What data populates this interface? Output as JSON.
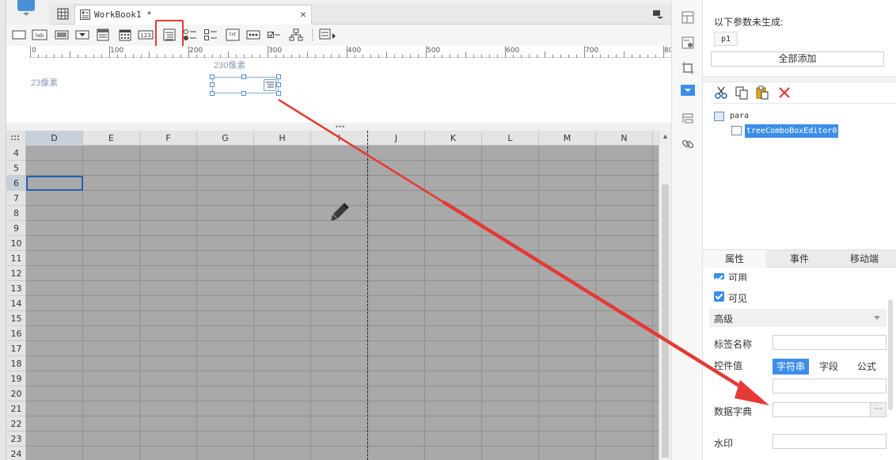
{
  "tab": {
    "title": "WorkBook1 *",
    "close_glyph": "×"
  },
  "toolbar": {
    "items": [
      {
        "icon": "text-box-icon"
      },
      {
        "icon": "label-icon",
        "text": "lab"
      },
      {
        "icon": "button-icon"
      },
      {
        "icon": "dropdown-icon"
      },
      {
        "icon": "combo-list-icon"
      },
      {
        "icon": "date-picker-icon"
      },
      {
        "icon": "number-field-icon",
        "text": "123"
      },
      {
        "icon": "tree-combo-box-icon"
      },
      {
        "icon": "radio-group-icon"
      },
      {
        "icon": "checkbox-group-icon"
      },
      {
        "icon": "text-area-icon",
        "text": "txt"
      },
      {
        "icon": "password-icon"
      },
      {
        "icon": "checkbox-icon"
      },
      {
        "icon": "tree-icon"
      },
      {
        "icon": "more-icon"
      }
    ],
    "highlight_color": "#e53935"
  },
  "ruler": {
    "labels": [
      "0",
      "100",
      "200",
      "300",
      "400",
      "500",
      "600",
      "700",
      "80"
    ]
  },
  "design": {
    "width_guide": "230像素",
    "height_guide": "23像素"
  },
  "sheet": {
    "columns": [
      "D",
      "E",
      "F",
      "G",
      "H",
      "I",
      "J",
      "K",
      "L",
      "M",
      "N"
    ],
    "selected_column": "D",
    "rows": [
      "4",
      "5",
      "6",
      "7",
      "8",
      "9",
      "10",
      "11",
      "12",
      "13",
      "14",
      "15",
      "16",
      "17",
      "18",
      "19",
      "20",
      "21",
      "22",
      "23",
      "24"
    ],
    "selected_row": "6"
  },
  "side_icons": [
    "layout-icon",
    "widget-settings-icon",
    "crop-icon",
    "combo-widget-icon",
    "component-icon",
    "link-icon"
  ],
  "panel": {
    "params_title": "以下参数未生成:",
    "param_chip": "p1",
    "add_all_label": "全部添加",
    "edit_tools": [
      "cut-icon",
      "copy-icon",
      "paste-icon",
      "delete-icon"
    ],
    "tree": {
      "root": "para",
      "child": "treeComboBoxEditor0"
    },
    "tabs": [
      "属性",
      "事件",
      "移动端"
    ],
    "active_tab": "属性",
    "enabled_label": "可用",
    "visible_label": "可见",
    "advanced_label": "高级",
    "label_name": "标签名称",
    "widget_value": "控件值",
    "value_types": [
      "字符串",
      "字段",
      "公式"
    ],
    "active_value_type": "字符串",
    "data_dict": "数据字典",
    "data_dict_btn": "···",
    "watermark": "水印"
  },
  "colors": {
    "accent": "#3c8ee8",
    "annotation": "#e53935",
    "sheet_bg": "#a9a9a9"
  }
}
